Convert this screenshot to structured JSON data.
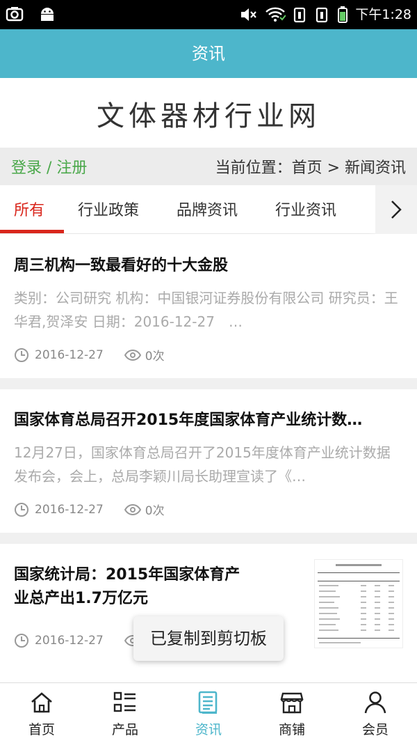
{
  "status_bar": {
    "time": "下午1:28"
  },
  "title_bar": {
    "title": "资讯"
  },
  "banner": {
    "site_name": "文体器材行业网"
  },
  "location_bar": {
    "login": "登录 / 注册",
    "location": "当前位置：首页 > 新闻资讯"
  },
  "tabs": [
    "所有",
    "行业政策",
    "品牌资讯",
    "行业资讯"
  ],
  "news": [
    {
      "title": "周三机构一致最看好的十大金股",
      "summary": "类别：公司研究 机构：中国银河证券股份有限公司 研究员：王华君,贺泽安 日期：2016-12-27　…",
      "date": "2016-12-27",
      "views": "0次"
    },
    {
      "title": "国家体育总局召开2015年度国家体育产业统计数…",
      "summary": "12月27日，国家体育总局召开了2015年度体育产业统计数据发布会，会上，总局李颖川局长助理宣读了《…",
      "date": "2016-12-27",
      "views": "0次"
    },
    {
      "title_line1": "国家统计局：2015年国家体育产",
      "title_line2": "业总产出1.7万亿元",
      "date": "2016-12-27"
    }
  ],
  "toast": {
    "text": "已复制到剪切板"
  },
  "bottom_nav": [
    {
      "label": "首页",
      "icon": "home-icon"
    },
    {
      "label": "产品",
      "icon": "list-icon"
    },
    {
      "label": "资讯",
      "icon": "article-icon",
      "active": true
    },
    {
      "label": "商铺",
      "icon": "store-icon"
    },
    {
      "label": "会员",
      "icon": "user-icon"
    }
  ],
  "colors": {
    "accent": "#4db6cb",
    "tab_active": "#d9261c",
    "login": "#4aa84a"
  }
}
